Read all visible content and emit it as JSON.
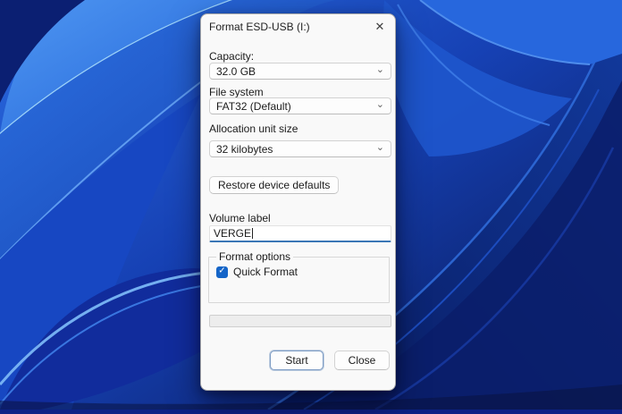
{
  "icons": {
    "close": "✕",
    "chevron_down": "⌄",
    "check": "✓"
  },
  "colors": {
    "accent_underline": "#3a76b5",
    "checkbox_blue": "#1565c8",
    "wallpaper_blue": "#1a4fd0"
  },
  "dialog": {
    "title": "Format ESD-USB (I:)",
    "capacity": {
      "label": "Capacity:",
      "value": "32.0 GB"
    },
    "file_system": {
      "label": "File system",
      "value": "FAT32 (Default)"
    },
    "allocation_unit": {
      "label": "Allocation unit size",
      "value": "32 kilobytes"
    },
    "restore_defaults_label": "Restore device defaults",
    "volume": {
      "label": "Volume label",
      "value": "VERGE"
    },
    "format_options": {
      "legend": "Format options",
      "quick_format": {
        "label": "Quick Format",
        "checked": true
      }
    },
    "progress_percent": 0,
    "buttons": {
      "start": "Start",
      "close": "Close"
    }
  }
}
